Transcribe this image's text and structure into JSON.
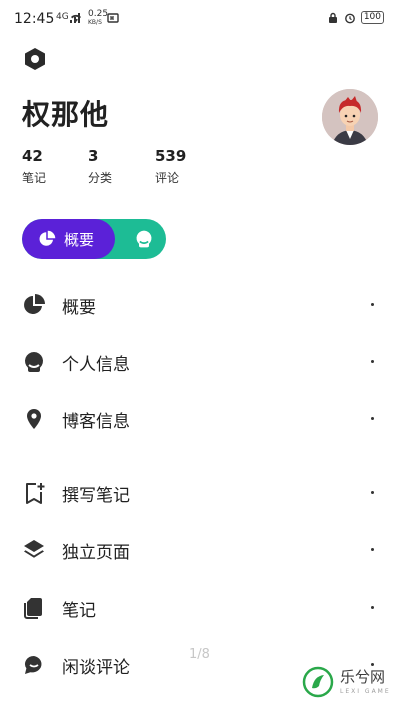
{
  "status_bar": {
    "time": "12:45",
    "network_label": "4G",
    "speed_value": "0.25",
    "speed_unit": "KB/S",
    "battery": "100"
  },
  "profile": {
    "name": "权那他",
    "stats": [
      {
        "value": "42",
        "label": "笔记"
      },
      {
        "value": "3",
        "label": "分类"
      },
      {
        "value": "539",
        "label": "评论"
      }
    ]
  },
  "toggle": {
    "active_label": "概要"
  },
  "menu": {
    "items": [
      {
        "label": "概要",
        "icon": "pie-chart-icon"
      },
      {
        "label": "个人信息",
        "icon": "user-face-icon"
      },
      {
        "label": "博客信息",
        "icon": "location-pin-icon"
      },
      {
        "label": "撰写笔记",
        "icon": "bookmark-add-icon"
      },
      {
        "label": "独立页面",
        "icon": "layers-icon"
      },
      {
        "label": "笔记",
        "icon": "notes-stack-icon"
      },
      {
        "label": "闲谈评论",
        "icon": "chat-bubble-icon"
      }
    ]
  },
  "pager": "1/8",
  "watermark": {
    "text": "乐兮网",
    "sub": "LEXI GAME"
  },
  "colors": {
    "accent_purple": "#5b21d8",
    "accent_green": "#1dbc95",
    "text": "#212121"
  }
}
